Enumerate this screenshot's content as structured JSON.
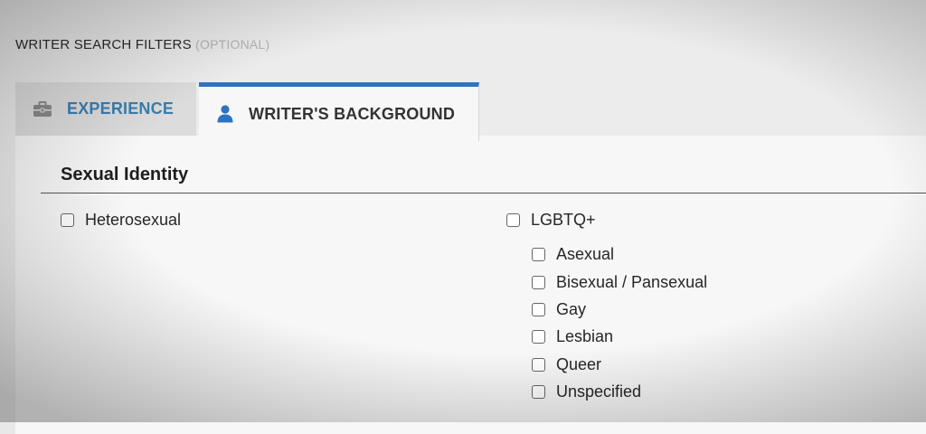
{
  "filters": {
    "title": "WRITER SEARCH FILTERS",
    "optional_tag": "(OPTIONAL)"
  },
  "tabs": [
    {
      "label": "EXPERIENCE",
      "icon": "briefcase-icon",
      "active": false
    },
    {
      "label": "WRITER'S BACKGROUND",
      "icon": "person-icon",
      "active": true
    }
  ],
  "section": {
    "title": "Sexual Identity",
    "options": [
      {
        "label": "Heterosexual",
        "checked": false
      },
      {
        "label": "LGBTQ+",
        "checked": false
      }
    ],
    "lgbtq_suboptions": [
      {
        "label": "Asexual",
        "checked": false
      },
      {
        "label": "Bisexual / Pansexual",
        "checked": false
      },
      {
        "label": "Gay",
        "checked": false
      },
      {
        "label": "Lesbian",
        "checked": false
      },
      {
        "label": "Queer",
        "checked": false
      },
      {
        "label": "Unspecified",
        "checked": false
      }
    ]
  },
  "colors": {
    "accent": "#2e73c2",
    "experience_tab_text": "#3a7eb0",
    "optional_text": "#b4b4b4"
  }
}
